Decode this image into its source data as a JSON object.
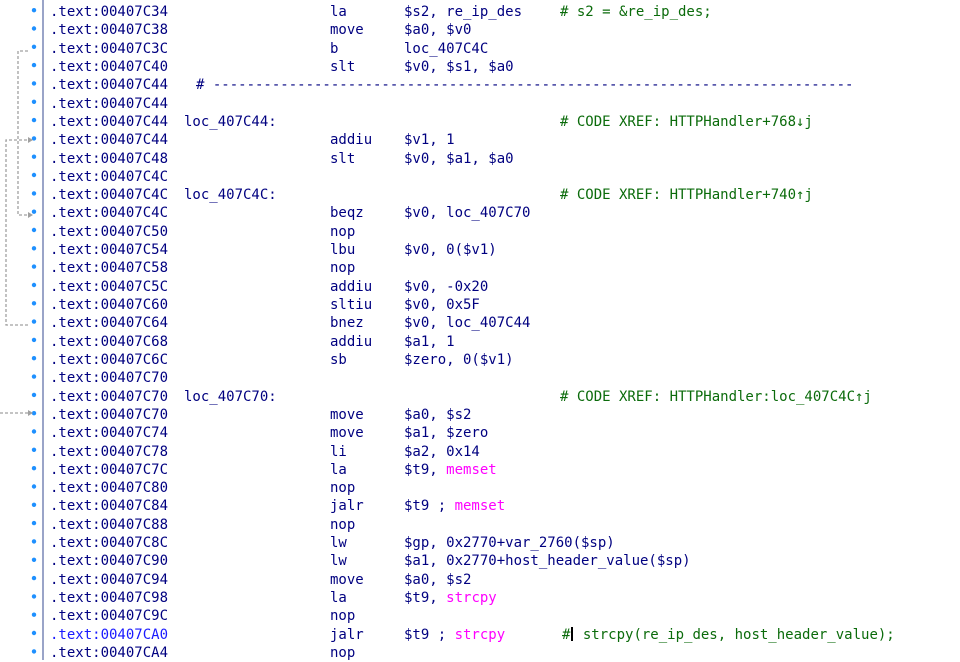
{
  "rows": [
    {
      "addr": ".text:00407C34",
      "mn": "la",
      "op": "$s2, re_ip_des",
      "cm": "# s2 = &re_ip_des;"
    },
    {
      "addr": ".text:00407C38",
      "mn": "move",
      "op": "$a0, $v0"
    },
    {
      "addr": ".text:00407C3C",
      "mn": "b",
      "op": "loc_407C4C"
    },
    {
      "addr": ".text:00407C40",
      "mn": "slt",
      "op": "$v0, $s1, $a0"
    },
    {
      "addr": ".text:00407C44",
      "sep": "# ----------------------------------------------------------------------------"
    },
    {
      "addr": ".text:00407C44"
    },
    {
      "addr": ".text:00407C44",
      "label": "loc_407C44:",
      "xref": "# CODE XREF: HTTPHandler+768↓j"
    },
    {
      "addr": ".text:00407C44",
      "mn": "addiu",
      "op": "$v1, 1"
    },
    {
      "addr": ".text:00407C48",
      "mn": "slt",
      "op": "$v0, $a1, $a0"
    },
    {
      "addr": ".text:00407C4C"
    },
    {
      "addr": ".text:00407C4C",
      "label": "loc_407C4C:",
      "xref": "# CODE XREF: HTTPHandler+740↑j"
    },
    {
      "addr": ".text:00407C4C",
      "mn": "beqz",
      "op": "$v0, loc_407C70"
    },
    {
      "addr": ".text:00407C50",
      "mn": "nop"
    },
    {
      "addr": ".text:00407C54",
      "mn": "lbu",
      "op": "$v0, 0($v1)"
    },
    {
      "addr": ".text:00407C58",
      "mn": "nop"
    },
    {
      "addr": ".text:00407C5C",
      "mn": "addiu",
      "op": "$v0, -0x20"
    },
    {
      "addr": ".text:00407C60",
      "mn": "sltiu",
      "op": "$v0, 0x5F"
    },
    {
      "addr": ".text:00407C64",
      "mn": "bnez",
      "op": "$v0, loc_407C44"
    },
    {
      "addr": ".text:00407C68",
      "mn": "addiu",
      "op": "$a1, 1"
    },
    {
      "addr": ".text:00407C6C",
      "mn": "sb",
      "op": "$zero, 0($v1)"
    },
    {
      "addr": ".text:00407C70"
    },
    {
      "addr": ".text:00407C70",
      "label": "loc_407C70:",
      "xref": "# CODE XREF: HTTPHandler:loc_407C4C↑j"
    },
    {
      "addr": ".text:00407C70",
      "mn": "move",
      "op": "$a0, $s2"
    },
    {
      "addr": ".text:00407C74",
      "mn": "move",
      "op": "$a1, $zero"
    },
    {
      "addr": ".text:00407C78",
      "mn": "li",
      "op": "$a2, 0x14"
    },
    {
      "addr": ".text:00407C7C",
      "mn": "la",
      "op": "$t9, ",
      "op_sym": "memset"
    },
    {
      "addr": ".text:00407C80",
      "mn": "nop"
    },
    {
      "addr": ".text:00407C84",
      "mn": "jalr",
      "op": "$t9 ; ",
      "op_sym": "memset"
    },
    {
      "addr": ".text:00407C88",
      "mn": "nop"
    },
    {
      "addr": ".text:00407C8C",
      "mn": "lw",
      "op": "$gp, 0x2770+var_2760($sp)"
    },
    {
      "addr": ".text:00407C90",
      "mn": "lw",
      "op": "$a1, 0x2770+host_header_value($sp)"
    },
    {
      "addr": ".text:00407C94",
      "mn": "move",
      "op": "$a0, $s2"
    },
    {
      "addr": ".text:00407C98",
      "mn": "la",
      "op": "$t9, ",
      "op_sym": "strcpy"
    },
    {
      "addr": ".text:00407C9C",
      "mn": "nop"
    },
    {
      "addr": ".text:00407CA0",
      "mn": "jalr",
      "op": "$t9 ; ",
      "op_sym": "strcpy",
      "cm": "# strcpy(re_ip_des, host_header_value);",
      "current": true
    },
    {
      "addr": ".text:00407CA4",
      "mn": "nop"
    }
  ]
}
